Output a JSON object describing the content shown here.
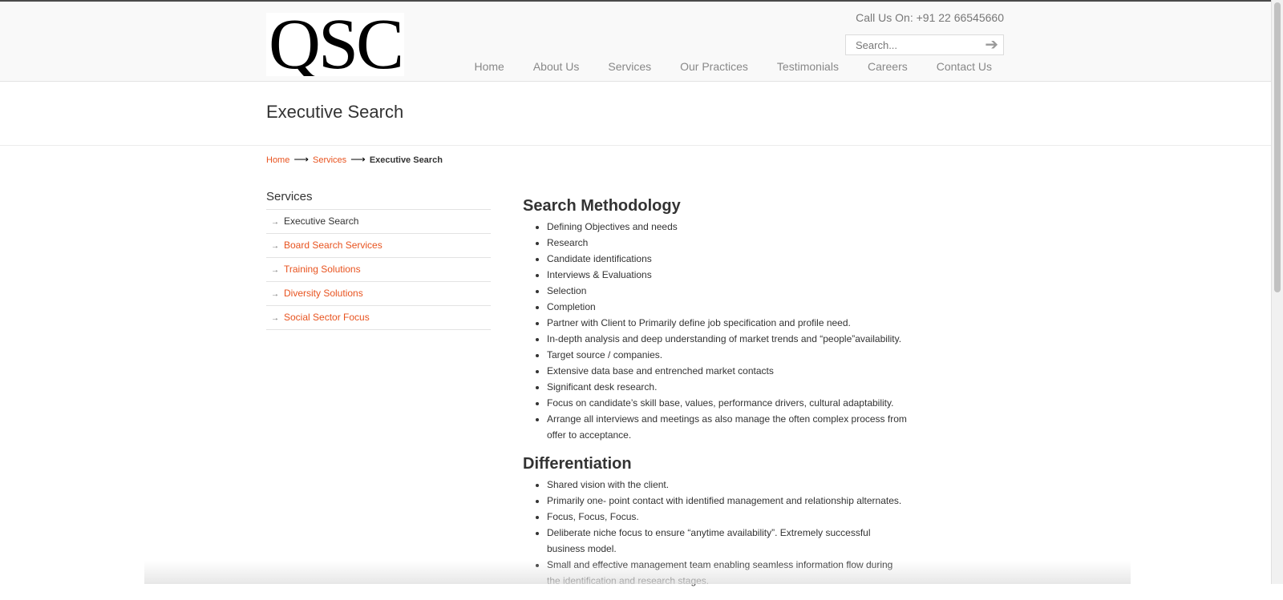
{
  "header": {
    "logo_text": "QSC",
    "phone": "Call Us On: +91 22 66545660",
    "search_placeholder": "Search...",
    "nav": [
      "Home",
      "About Us",
      "Services",
      "Our Practices",
      "Testimonials",
      "Careers",
      "Contact Us"
    ]
  },
  "page_title": "Executive Search",
  "breadcrumb": {
    "home": "Home",
    "services": "Services",
    "current": "Executive Search",
    "separator": "⟶"
  },
  "sidebar": {
    "title": "Services",
    "items": [
      "Executive Search",
      "Board Search Services",
      "Training Solutions",
      "Diversity Solutions",
      "Social Sector Focus"
    ]
  },
  "content": {
    "methodology_heading": "Search Methodology",
    "methodology": [
      "Defining Objectives and needs",
      "Research",
      "Candidate identifications",
      "Interviews & Evaluations",
      "Selection",
      "Completion",
      "Partner with Client to Primarily define job specification and profile need.",
      "In-depth analysis and deep understanding of market trends and “people”availability.",
      "Target source / companies.",
      "Extensive data base and entrenched market contacts",
      "Significant desk research.",
      "Focus on candidate’s skill base, values, performance drivers, cultural adaptability.",
      "Arrange all interviews and meetings as also manage the often complex process from offer to acceptance."
    ],
    "differentiation_heading": "Differentiation",
    "differentiation": [
      "Shared vision with the client.",
      "Primarily one- point contact with identified management and relationship alternates.",
      "Focus, Focus, Focus.",
      "Deliberate niche focus to ensure “anytime availability”. Extremely successful business model.",
      "Small and effective management team enabling seamless information flow during the identification and research stages."
    ]
  },
  "colors": {
    "accent": "#e8531f",
    "header_bg": "#f9f9f9",
    "nav_text": "#888888"
  }
}
